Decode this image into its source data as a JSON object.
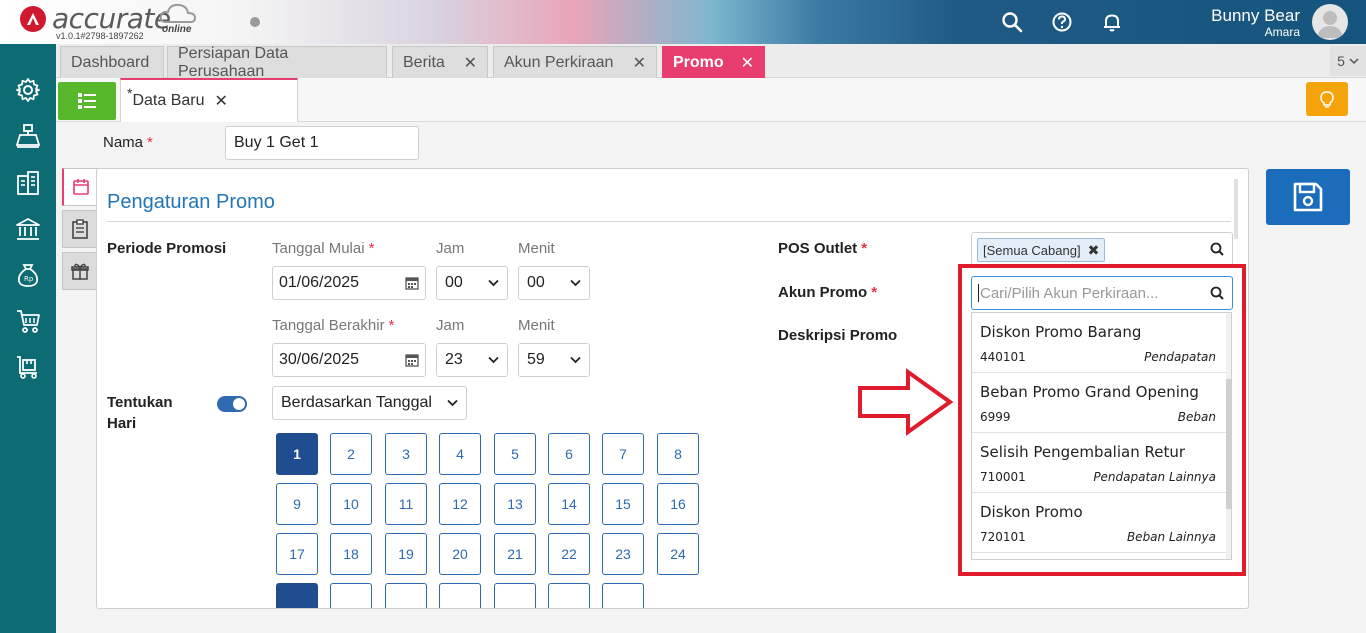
{
  "brand": {
    "name": "accurate",
    "suffix": "online",
    "version": "v1.0.1#2798-1897262"
  },
  "header": {
    "user_name": "Bunny Bear",
    "user_subtitle": "Amara"
  },
  "tabs": [
    {
      "label": "Dashboard",
      "closable": false
    },
    {
      "label": "Persiapan Data Perusahaan",
      "closable": false
    },
    {
      "label": "Berita",
      "closable": true
    },
    {
      "label": "Akun Perkiraan",
      "closable": true
    },
    {
      "label": "Promo",
      "closable": true,
      "active": true
    }
  ],
  "tab_count": "5",
  "subtab": {
    "asterisk": "*",
    "label": "Data Baru"
  },
  "form": {
    "nama_label": "Nama",
    "nama_value": "Buy 1 Get 1",
    "required_mark": "*"
  },
  "panel": {
    "title": "Pengaturan Promo",
    "periode_label": "Periode Promosi",
    "tanggal_mulai_label": "Tanggal Mulai",
    "tanggal_mulai_value": "01/06/2025",
    "jam_label": "Jam",
    "menit_label": "Menit",
    "mulai_jam": "00",
    "mulai_menit": "00",
    "tanggal_berakhir_label": "Tanggal Berakhir",
    "tanggal_berakhir_value": "30/06/2025",
    "berakhir_jam": "23",
    "berakhir_menit": "59",
    "tentukan_hari_label_1": "Tentukan",
    "tentukan_hari_label_2": "Hari",
    "tentukan_hari_on": true,
    "mode_select": "Berdasarkan Tanggal",
    "days": [
      "1",
      "2",
      "3",
      "4",
      "5",
      "6",
      "7",
      "8",
      "9",
      "10",
      "11",
      "12",
      "13",
      "14",
      "15",
      "16",
      "17",
      "18",
      "19",
      "20",
      "21",
      "22",
      "23",
      "24"
    ],
    "selected_days": [
      "1"
    ],
    "pos_outlet_label": "POS Outlet",
    "pos_outlet_tag": "[Semua Cabang]",
    "akun_promo_label": "Akun Promo",
    "akun_promo_placeholder": "Cari/Pilih Akun Perkiraan...",
    "deskripsi_label": "Deskripsi Promo"
  },
  "dropdown": [
    {
      "name": "Diskon Promo Barang",
      "code": "440101",
      "type": "Pendapatan"
    },
    {
      "name": "Beban Promo Grand Opening",
      "code": "6999",
      "type": "Beban"
    },
    {
      "name": "Selisih Pengembalian Retur",
      "code": "710001",
      "type": "Pendapatan Lainnya"
    },
    {
      "name": "Diskon Promo",
      "code": "720101",
      "type": "Beban Lainnya"
    }
  ],
  "colors": {
    "accent_pink": "#e83e6f",
    "primary_blue": "#1c6cbc",
    "sidebar_teal": "#0c6b73",
    "green": "#58b82c",
    "orange": "#f5a30a",
    "annotation_red": "#e01b2b"
  },
  "icons": {
    "sidebar": [
      "gear-icon",
      "cash-register-icon",
      "building-icon",
      "bank-icon",
      "money-bag-icon",
      "cart-icon",
      "box-cart-icon"
    ],
    "header": [
      "search-icon",
      "help-icon",
      "bell-icon",
      "avatar-icon"
    ]
  }
}
